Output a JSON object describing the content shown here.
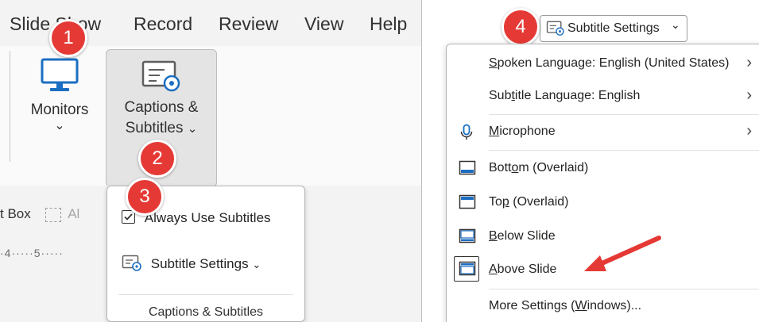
{
  "ribbon": {
    "tabs": [
      {
        "label": "Slide Show"
      },
      {
        "label": "Record"
      },
      {
        "label": "Review"
      },
      {
        "label": "View"
      },
      {
        "label": "Help"
      }
    ],
    "monitors": {
      "label": "Monitors",
      "chevron": "⌄",
      "icon": "monitor-icon"
    },
    "captions_button": {
      "line1": "Captions &",
      "line2": "Subtitles",
      "chevron": "⌄",
      "icon": "captions-settings-icon"
    },
    "text_box": "t Box",
    "align_partial": "Al",
    "ruler": "·4·····5·····",
    "dropdown": {
      "always_use": "Always Use Subtitles",
      "always_use_checked": true,
      "subtitle_settings": "Subtitle Settings",
      "footer": "Captions & Subtitles"
    }
  },
  "subtitle_menu": {
    "button_label": "Subtitle Settings",
    "items": [
      {
        "pre": "",
        "ul": "S",
        "post": "poken Language: English (United States)",
        "submenu": true
      },
      {
        "pre": "Sub",
        "ul": "t",
        "post": "itle Language: English",
        "submenu": true
      },
      {
        "pre": "",
        "ul": "M",
        "post": "icrophone",
        "submenu": true,
        "icon": "microphone-icon"
      },
      {
        "pre": "Bott",
        "ul": "o",
        "post": "m (Overlaid)",
        "icon": "bottom-overlaid-icon"
      },
      {
        "pre": "To",
        "ul": "p",
        "post": " (Overlaid)",
        "icon": "top-overlaid-icon"
      },
      {
        "pre": "",
        "ul": "B",
        "post": "elow Slide",
        "icon": "below-slide-icon"
      },
      {
        "pre": "",
        "ul": "A",
        "post": "bove Slide",
        "icon": "above-slide-icon",
        "selected": true
      },
      {
        "pre": "More Settings (",
        "ul": "W",
        "post": "indows)..."
      }
    ]
  },
  "badges": [
    "1",
    "2",
    "3",
    "4"
  ],
  "colors": {
    "badge": "#e53935",
    "arrow": "#e53935",
    "ribbon": "#f3f3f3",
    "accent_icon": "#1b6ec2"
  }
}
